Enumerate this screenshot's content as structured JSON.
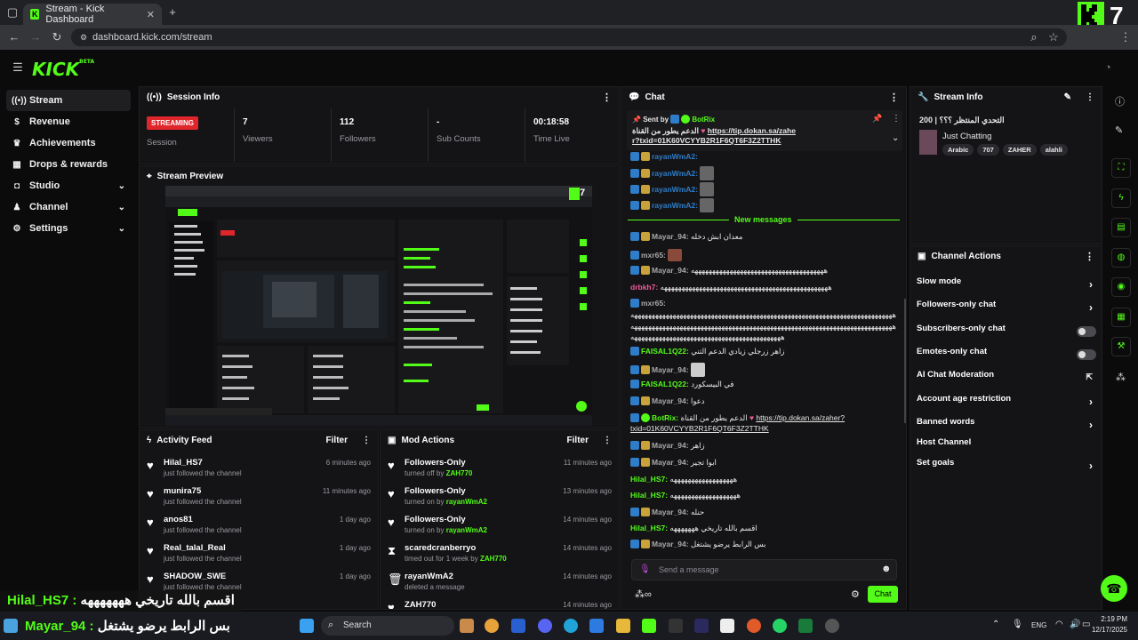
{
  "browser": {
    "tab_title": "Stream - Kick Dashboard",
    "url": "dashboard.kick.com/stream"
  },
  "brand": {
    "logo": "KICK",
    "beta": "BETA"
  },
  "sidebar": {
    "items": [
      {
        "label": "Stream",
        "icon": "broadcast-icon"
      },
      {
        "label": "Revenue",
        "icon": "dollar-icon"
      },
      {
        "label": "Achievements",
        "icon": "trophy-icon"
      },
      {
        "label": "Drops & rewards",
        "icon": "gift-icon"
      },
      {
        "label": "Studio",
        "icon": "studio-icon"
      },
      {
        "label": "Channel",
        "icon": "channel-icon"
      },
      {
        "label": "Settings",
        "icon": "gear-icon"
      }
    ]
  },
  "session": {
    "title": "Session Info",
    "status": "STREAMING",
    "status_label": "Session",
    "stats": [
      {
        "value": "7",
        "label": "Viewers"
      },
      {
        "value": "112",
        "label": "Followers"
      },
      {
        "value": "-",
        "label": "Sub Counts"
      },
      {
        "value": "00:18:58",
        "label": "Time Live"
      }
    ]
  },
  "preview": {
    "title": "Stream Preview",
    "viewer_count": "7"
  },
  "activity": {
    "title": "Activity Feed",
    "filter": "Filter",
    "rows": [
      {
        "name": "Hilal_HS7",
        "sub": "just followed the channel",
        "time": "6 minutes ago"
      },
      {
        "name": "munira75",
        "sub": "just followed the channel",
        "time": "11 minutes ago"
      },
      {
        "name": "anos81",
        "sub": "just followed the channel",
        "time": "1 day ago"
      },
      {
        "name": "Real_talal_Real",
        "sub": "just followed the channel",
        "time": "1 day ago"
      },
      {
        "name": "SHADOW_SWE",
        "sub": "just followed the channel",
        "time": "1 day ago"
      }
    ]
  },
  "mod": {
    "title": "Mod Actions",
    "filter": "Filter",
    "rows": [
      {
        "name": "Followers-Only",
        "sub": "turned off by",
        "who": "ZAH770",
        "time": "11 minutes ago",
        "icon": "heart-icon"
      },
      {
        "name": "Followers-Only",
        "sub": "turned on by",
        "who": "rayanWmA2",
        "time": "13 minutes ago",
        "icon": "heart-icon"
      },
      {
        "name": "Followers-Only",
        "sub": "turned on by",
        "who": "rayanWmA2",
        "time": "14 minutes ago",
        "icon": "heart-icon"
      },
      {
        "name": "scaredcranberryo",
        "sub": "timed out for 1 week by",
        "who": "ZAH770",
        "time": "14 minutes ago",
        "icon": "hourglass-icon"
      },
      {
        "name": "rayanWmA2",
        "sub": "deleted a message",
        "who": "",
        "time": "14 minutes ago",
        "icon": "trash-icon"
      },
      {
        "name": "ZAH770",
        "sub": "",
        "who": "",
        "time": "14 minutes ago",
        "icon": "heart-icon"
      }
    ]
  },
  "chat": {
    "title": "Chat",
    "pinned_by_label": "Sent by",
    "pinned_by": "BotRix",
    "pinned_text": "الدعم يطور من القناة",
    "pinned_link": "https://tip.dokan.sa/zaher?txid=01K60VCYYB2R1F6QT6F3Z2TTHK",
    "new_messages": "New messages",
    "messages": [
      {
        "user": "rayanWmA2:",
        "text": "",
        "color": "#2f7dc8"
      },
      {
        "user": "rayanWmA2:",
        "text": "",
        "color": "#2f7dc8"
      },
      {
        "user": "rayanWmA2:",
        "text": "",
        "color": "#2f7dc8"
      },
      {
        "user": "Mayar_94:",
        "text": "معدان ابش دخله",
        "color": "#a8a8a8"
      },
      {
        "user": "mxr65:",
        "text": "",
        "color": "#a8a8a8"
      },
      {
        "user": "Mayar_94:",
        "text": "ههههههههههههههههههههههههههههههههههههههه",
        "color": "#a8a8a8"
      },
      {
        "user": "drbkh7:",
        "text": "ههههههههههههههههههههههههههههههههههههههههههههههههه",
        "color": "#f05a9b"
      },
      {
        "user": "mxr65:",
        "text": "",
        "color": "#a8a8a8"
      },
      {
        "user": "FAISAL1Q22:",
        "text": "زاهر زرجلي زيادي الدعم التني",
        "color": "#53fc18"
      },
      {
        "user": "Mayar_94:",
        "text": "",
        "color": "#a8a8a8"
      },
      {
        "user": "FAISAL1Q22:",
        "text": "في البيسكورد",
        "color": "#53fc18"
      },
      {
        "user": "Mayar_94:",
        "text": "دعوا",
        "color": "#a8a8a8"
      },
      {
        "user": "BotRix:",
        "text": "الدعم يطور من القناة",
        "color": "#53fc18"
      },
      {
        "user": "Mayar_94:",
        "text": "زاهر",
        "color": "#a8a8a8"
      },
      {
        "user": "Mayar_94:",
        "text": "ابوا تجير",
        "color": "#a8a8a8"
      },
      {
        "user": "Hilal_HS7:",
        "text": "ههههههههههههههههههه",
        "color": "#53fc18"
      },
      {
        "user": "Hilal_HS7:",
        "text": "هههههههههههههههههههه",
        "color": "#53fc18"
      },
      {
        "user": "Mayar_94:",
        "text": "حنله",
        "color": "#a8a8a8"
      },
      {
        "user": "Hilal_HS7:",
        "text": "اقسم بالله تاريخي هههههههه",
        "color": "#53fc18"
      },
      {
        "user": "Mayar_94:",
        "text": "بس الرابط يرضو يشتغل",
        "color": "#a8a8a8"
      }
    ],
    "long_line_1": "هههههههههههههههههههههههههههههههههههههههههههههههههههههههههههههههههههههههههههه",
    "long_line_2": "هههههههههههههههههههههههههههههههههههههههههههههههههههههههههههههههههههههههههههه",
    "long_line_3": "هههههههههههههههههههههههههههههههههههههههههههه",
    "botrix_link": "https://tip.dokan.sa/zaher?txid=01K60VCYYB2R1F6QT6F3Z2TTHK",
    "placeholder": "Send a message",
    "send": "Chat"
  },
  "stream_info": {
    "title": "Stream Info",
    "stream_title": "200 | التحدي المنتظر ؟؟؟",
    "category": "Just Chatting",
    "tags": [
      "Arabic",
      "707",
      "ZAHER",
      "alahli"
    ]
  },
  "actions": {
    "title": "Channel Actions",
    "rows": [
      {
        "label": "Slow mode",
        "kind": "chevron"
      },
      {
        "label": "Followers-only chat",
        "kind": "chevron"
      },
      {
        "label": "Subscribers-only chat",
        "kind": "toggle"
      },
      {
        "label": "Emotes-only chat",
        "kind": "toggle"
      },
      {
        "label": "AI Chat Moderation",
        "kind": "external"
      },
      {
        "label": "Account age restriction",
        "kind": "chevron"
      },
      {
        "label": "Banned words",
        "kind": "chevron"
      },
      {
        "label": "Host Channel",
        "kind": "none"
      },
      {
        "label": "Set goals",
        "kind": "chevron"
      }
    ]
  },
  "overlay": {
    "line1_user": "Hilal_HS7 :",
    "line1_text": "اقسم بالله تاريخي هههههههه",
    "line2_user": "Mayar_94 :",
    "line2_text": "بس الرابط يرضو يشتغل"
  },
  "corner_badge": "7",
  "taskbar": {
    "search": "Search",
    "lang": "ENG",
    "time": "2:19 PM",
    "date": "12/17/2025"
  }
}
